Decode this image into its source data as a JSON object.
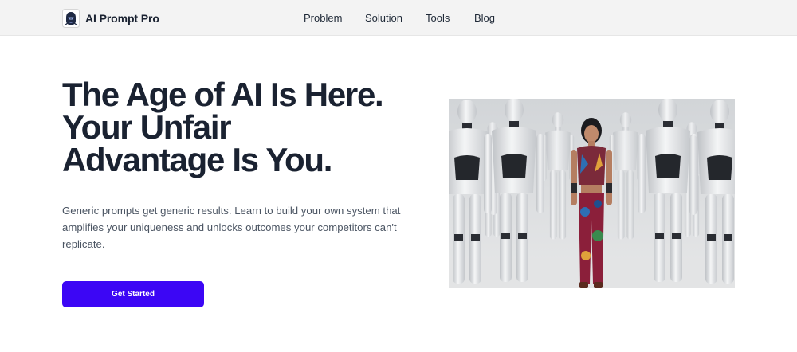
{
  "brand": {
    "name": "AI Prompt Pro",
    "logo_icon": "robot-head-icon"
  },
  "nav": {
    "items": [
      "Problem",
      "Solution",
      "Tools",
      "Blog"
    ]
  },
  "hero": {
    "title_lines": [
      "The Age of AI Is Here.",
      "Your Unfair",
      "Advantage Is You."
    ],
    "subtitle": "Generic prompts get generic results. Learn to build your own system that amplifies your uniqueness and unlocks outcomes your competitors can't replicate.",
    "cta_label": "Get Started",
    "image_subject": "woman-among-robots-image"
  },
  "colors": {
    "accent": "#3c06f5",
    "heading": "#1a2231",
    "body_text": "#4b5563",
    "navbar_bg": "#f3f3f3"
  }
}
